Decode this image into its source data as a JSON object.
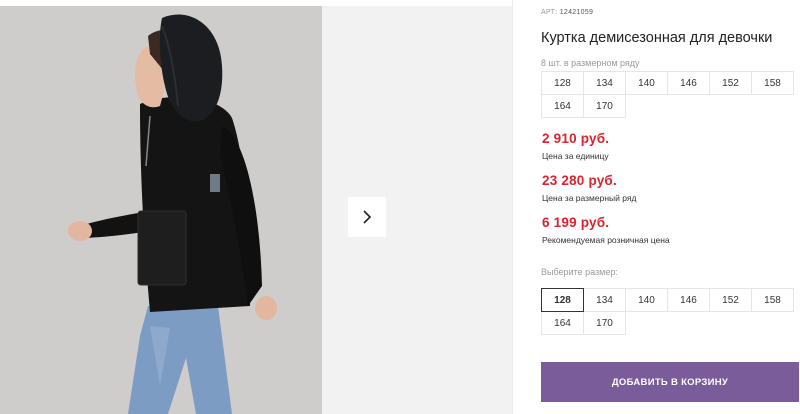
{
  "product": {
    "article_label": "АРТ:",
    "article_number": "12421059",
    "title": "Куртка демисезонная для девочки",
    "sizes_in_row_caption": "8 шт. в размерном ряду",
    "sizes_in_row": [
      "128",
      "134",
      "140",
      "146",
      "152",
      "158",
      "164",
      "170"
    ]
  },
  "prices": {
    "unit_price": "2 910 руб.",
    "unit_caption": "Цена за единицу",
    "row_price": "23 280 руб.",
    "row_caption": "Цена за размерный ряд",
    "retail_price": "6 199 руб.",
    "retail_caption": "Рекомендуемая розничная цена",
    "price_color": "#d9232e"
  },
  "size_select": {
    "label": "Выберите размер:",
    "options": [
      "128",
      "134",
      "140",
      "146",
      "152",
      "158",
      "164",
      "170"
    ],
    "selected": "128"
  },
  "cart": {
    "button_label": "ДОБАВИТЬ В КОРЗИНУ",
    "button_color": "#7b5c9b"
  },
  "gallery": {
    "next_icon": "chevron-right-icon"
  }
}
